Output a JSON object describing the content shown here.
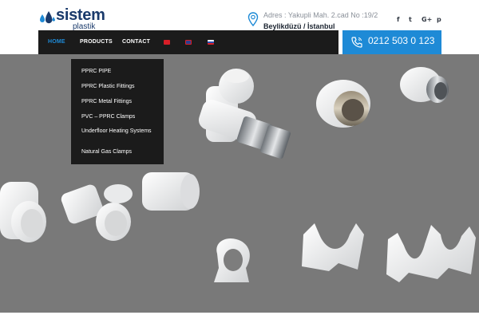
{
  "logo": {
    "name": "sistem",
    "subtitle": "plastik",
    "brand_color": "#1a3a6b",
    "accent": "#1e8ad6",
    "icon": "water-drops-icon"
  },
  "address": {
    "line1": "Adres : Yakupli Mah. 2.cad No :19/2",
    "line2": "Beylikdüzü / İstanbul",
    "icon": "map-pin-icon"
  },
  "social": [
    {
      "name": "facebook-icon",
      "glyph": "f"
    },
    {
      "name": "twitter-icon",
      "glyph": "t"
    },
    {
      "name": "google-plus-icon",
      "glyph": "G+"
    },
    {
      "name": "pinterest-icon",
      "glyph": "p"
    }
  ],
  "nav": {
    "items": [
      {
        "label": "HOME",
        "active": true
      },
      {
        "label": "PRODUCTS",
        "active": false
      },
      {
        "label": "CONTACT",
        "active": false
      }
    ],
    "flags": [
      {
        "name": "turkish-flag-icon",
        "color": "#d81e27"
      },
      {
        "name": "english-flag-icon",
        "color": "#2a3f8f"
      },
      {
        "name": "russian-flag-icon",
        "color": "#ffffff"
      }
    ]
  },
  "phone": {
    "number": "0212 503 0 123",
    "icon": "phone-icon",
    "bg": "#1e8ad6"
  },
  "dropdown": {
    "items": [
      "PPRC PIPE",
      "PPRC Plastic Fittings",
      "PPRC Metal Fittings",
      "PVC – PPRC Clamps",
      "Underfloor Heating Systems",
      "Natural Gas Clamps"
    ]
  },
  "hero": {
    "bg": "#797979"
  }
}
